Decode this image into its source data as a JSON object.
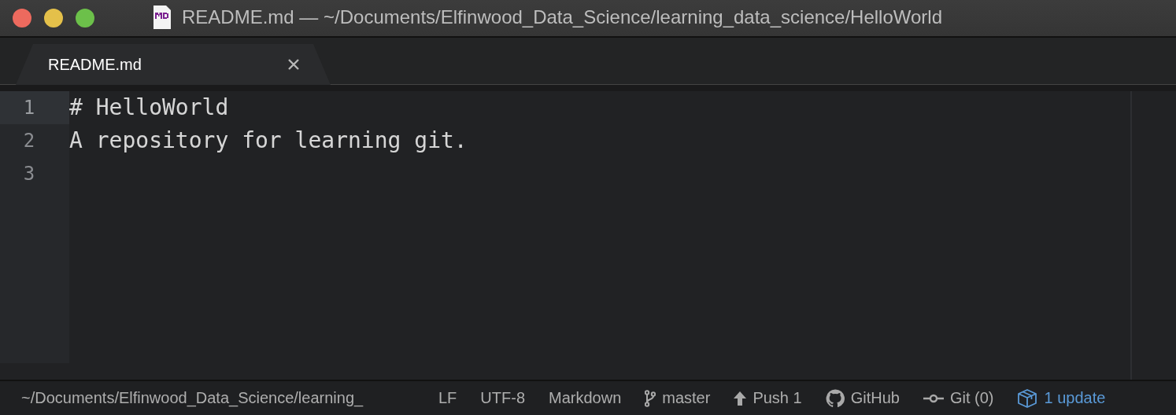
{
  "window": {
    "title": "README.md — ~/Documents/Elfinwood_Data_Science/learning_data_science/HelloWorld"
  },
  "tabs": [
    {
      "label": "README.md",
      "selected": true
    }
  ],
  "editor": {
    "lines": [
      {
        "number": "1",
        "text": "# HelloWorld",
        "current": true
      },
      {
        "number": "2",
        "text": "A repository for learning git.",
        "current": false
      },
      {
        "number": "3",
        "current": false
      }
    ]
  },
  "status_bar": {
    "path": "~/Documents/Elfinwood_Data_Science/learning_",
    "items": [
      {
        "kind": "plain",
        "label": "LF"
      },
      {
        "kind": "plain",
        "label": "UTF-8"
      },
      {
        "kind": "plain",
        "label": "Markdown"
      },
      {
        "kind": "branch",
        "label": "master"
      },
      {
        "kind": "push",
        "label": "Push 1"
      },
      {
        "kind": "github",
        "label": "GitHub"
      },
      {
        "kind": "commit",
        "label": "Git (0)"
      },
      {
        "kind": "update",
        "label": "1 update"
      }
    ]
  }
}
